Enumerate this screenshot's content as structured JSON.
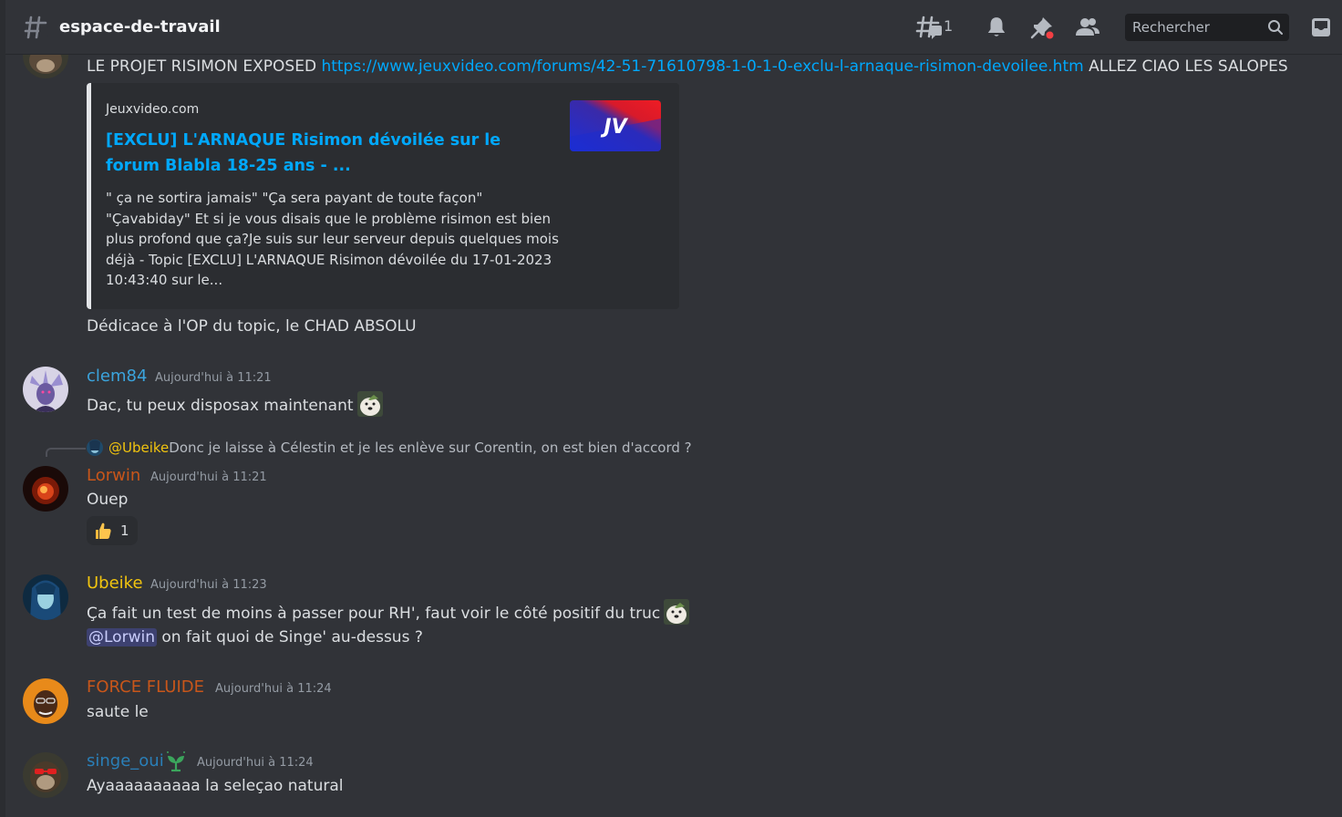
{
  "header": {
    "channel_name": "espace-de-travail",
    "threads_count": "1",
    "search_placeholder": "Rechercher"
  },
  "messages": {
    "m0": {
      "text_prefix": "LE PROJET RISIMON EXPOSED ",
      "link": "https://www.jeuxvideo.com/forums/42-51-71610798-1-0-1-0-exclu-l-arnaque-risimon-devoilee.htm",
      "text_suffix": " ALLEZ CIAO LES SALOPES",
      "embed": {
        "provider": "Jeuxvideo.com",
        "title": "[EXCLU] L'ARNAQUE Risimon dévoilée sur le forum Blabla 18-25 ans - ...",
        "description": "\" ça ne sortira jamais\" \"Ça sera payant de toute façon\" \"Çavabiday\" Et si je vous disais que le problème risimon est bien plus profond que ça?Je suis sur leur serveur depuis quelques mois déjà - Topic [EXCLU] L'ARNAQUE Risimon dévoilée du 17-01-2023 10:43:40 sur le...",
        "thumb_logo": "JV"
      },
      "followup": "Dédicace à l'OP du topic, le CHAD ABSOLU"
    },
    "m1": {
      "username": "clem84",
      "timestamp": "Aujourd'hui à 11:21",
      "text": "Dac, tu peux disposax maintenant"
    },
    "m2": {
      "reply_mention": "@Ubeike",
      "reply_text": " Donc je laisse à Célestin et je les enlève sur Corentin, on est bien d'accord ?",
      "username": "Lorwin",
      "timestamp": "Aujourd'hui à 11:21",
      "text": "Ouep",
      "reaction_count": "1"
    },
    "m3": {
      "username": "Ubeike",
      "timestamp": "Aujourd'hui à 11:23",
      "text": "Ça fait un test de moins à passer pour RH', faut voir le côté positif du truc",
      "mention": "@Lorwin",
      "text2": " on fait quoi de Singe' au-dessus ?"
    },
    "m4": {
      "username": "FORCE FLUIDE",
      "timestamp": "Aujourd'hui à 11:24",
      "text": "saute le"
    },
    "m5": {
      "username": "singe_oui",
      "timestamp": "Aujourd'hui à 11:24",
      "text": "Ayaaaaaaaaaa la seleçao natural"
    }
  },
  "colors": {
    "clem84": "#3ba4dd",
    "Lorwin": "#c8561a",
    "Ubeike": "#f1c40f",
    "FORCE FLUIDE": "#c8561a",
    "singe_oui": "#2a7fb8",
    "link": "#00a8fc"
  }
}
